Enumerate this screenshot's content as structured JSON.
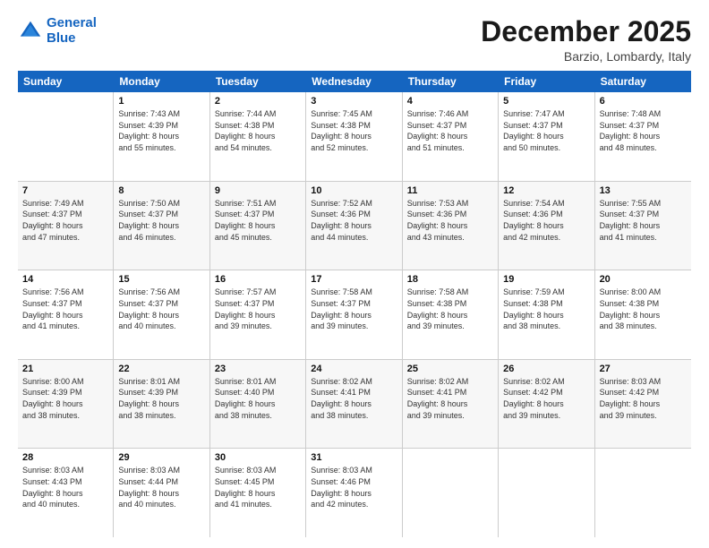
{
  "logo": {
    "line1": "General",
    "line2": "Blue"
  },
  "title": "December 2025",
  "location": "Barzio, Lombardy, Italy",
  "header_days": [
    "Sunday",
    "Monday",
    "Tuesday",
    "Wednesday",
    "Thursday",
    "Friday",
    "Saturday"
  ],
  "weeks": [
    [
      {
        "day": "",
        "info": ""
      },
      {
        "day": "1",
        "info": "Sunrise: 7:43 AM\nSunset: 4:39 PM\nDaylight: 8 hours\nand 55 minutes."
      },
      {
        "day": "2",
        "info": "Sunrise: 7:44 AM\nSunset: 4:38 PM\nDaylight: 8 hours\nand 54 minutes."
      },
      {
        "day": "3",
        "info": "Sunrise: 7:45 AM\nSunset: 4:38 PM\nDaylight: 8 hours\nand 52 minutes."
      },
      {
        "day": "4",
        "info": "Sunrise: 7:46 AM\nSunset: 4:37 PM\nDaylight: 8 hours\nand 51 minutes."
      },
      {
        "day": "5",
        "info": "Sunrise: 7:47 AM\nSunset: 4:37 PM\nDaylight: 8 hours\nand 50 minutes."
      },
      {
        "day": "6",
        "info": "Sunrise: 7:48 AM\nSunset: 4:37 PM\nDaylight: 8 hours\nand 48 minutes."
      }
    ],
    [
      {
        "day": "7",
        "info": "Sunrise: 7:49 AM\nSunset: 4:37 PM\nDaylight: 8 hours\nand 47 minutes."
      },
      {
        "day": "8",
        "info": "Sunrise: 7:50 AM\nSunset: 4:37 PM\nDaylight: 8 hours\nand 46 minutes."
      },
      {
        "day": "9",
        "info": "Sunrise: 7:51 AM\nSunset: 4:37 PM\nDaylight: 8 hours\nand 45 minutes."
      },
      {
        "day": "10",
        "info": "Sunrise: 7:52 AM\nSunset: 4:36 PM\nDaylight: 8 hours\nand 44 minutes."
      },
      {
        "day": "11",
        "info": "Sunrise: 7:53 AM\nSunset: 4:36 PM\nDaylight: 8 hours\nand 43 minutes."
      },
      {
        "day": "12",
        "info": "Sunrise: 7:54 AM\nSunset: 4:36 PM\nDaylight: 8 hours\nand 42 minutes."
      },
      {
        "day": "13",
        "info": "Sunrise: 7:55 AM\nSunset: 4:37 PM\nDaylight: 8 hours\nand 41 minutes."
      }
    ],
    [
      {
        "day": "14",
        "info": "Sunrise: 7:56 AM\nSunset: 4:37 PM\nDaylight: 8 hours\nand 41 minutes."
      },
      {
        "day": "15",
        "info": "Sunrise: 7:56 AM\nSunset: 4:37 PM\nDaylight: 8 hours\nand 40 minutes."
      },
      {
        "day": "16",
        "info": "Sunrise: 7:57 AM\nSunset: 4:37 PM\nDaylight: 8 hours\nand 39 minutes."
      },
      {
        "day": "17",
        "info": "Sunrise: 7:58 AM\nSunset: 4:37 PM\nDaylight: 8 hours\nand 39 minutes."
      },
      {
        "day": "18",
        "info": "Sunrise: 7:58 AM\nSunset: 4:38 PM\nDaylight: 8 hours\nand 39 minutes."
      },
      {
        "day": "19",
        "info": "Sunrise: 7:59 AM\nSunset: 4:38 PM\nDaylight: 8 hours\nand 38 minutes."
      },
      {
        "day": "20",
        "info": "Sunrise: 8:00 AM\nSunset: 4:38 PM\nDaylight: 8 hours\nand 38 minutes."
      }
    ],
    [
      {
        "day": "21",
        "info": "Sunrise: 8:00 AM\nSunset: 4:39 PM\nDaylight: 8 hours\nand 38 minutes."
      },
      {
        "day": "22",
        "info": "Sunrise: 8:01 AM\nSunset: 4:39 PM\nDaylight: 8 hours\nand 38 minutes."
      },
      {
        "day": "23",
        "info": "Sunrise: 8:01 AM\nSunset: 4:40 PM\nDaylight: 8 hours\nand 38 minutes."
      },
      {
        "day": "24",
        "info": "Sunrise: 8:02 AM\nSunset: 4:41 PM\nDaylight: 8 hours\nand 38 minutes."
      },
      {
        "day": "25",
        "info": "Sunrise: 8:02 AM\nSunset: 4:41 PM\nDaylight: 8 hours\nand 39 minutes."
      },
      {
        "day": "26",
        "info": "Sunrise: 8:02 AM\nSunset: 4:42 PM\nDaylight: 8 hours\nand 39 minutes."
      },
      {
        "day": "27",
        "info": "Sunrise: 8:03 AM\nSunset: 4:42 PM\nDaylight: 8 hours\nand 39 minutes."
      }
    ],
    [
      {
        "day": "28",
        "info": "Sunrise: 8:03 AM\nSunset: 4:43 PM\nDaylight: 8 hours\nand 40 minutes."
      },
      {
        "day": "29",
        "info": "Sunrise: 8:03 AM\nSunset: 4:44 PM\nDaylight: 8 hours\nand 40 minutes."
      },
      {
        "day": "30",
        "info": "Sunrise: 8:03 AM\nSunset: 4:45 PM\nDaylight: 8 hours\nand 41 minutes."
      },
      {
        "day": "31",
        "info": "Sunrise: 8:03 AM\nSunset: 4:46 PM\nDaylight: 8 hours\nand 42 minutes."
      },
      {
        "day": "",
        "info": ""
      },
      {
        "day": "",
        "info": ""
      },
      {
        "day": "",
        "info": ""
      }
    ]
  ]
}
